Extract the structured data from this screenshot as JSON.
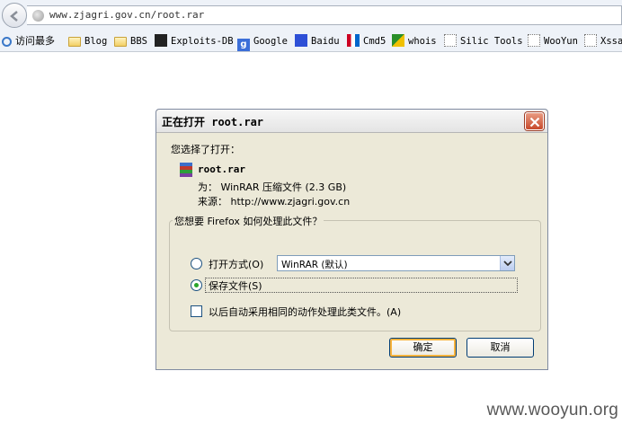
{
  "browser": {
    "url": "www.zjagri.gov.cn/root.rar",
    "bookmarks": [
      {
        "label": "访问最多",
        "icon": "search-icon"
      },
      {
        "label": "Blog",
        "icon": "folder-icon"
      },
      {
        "label": "BBS",
        "icon": "folder-icon"
      },
      {
        "label": "Exploits-DB",
        "icon": "exploits-db-icon"
      },
      {
        "label": "Google",
        "icon": "google-icon"
      },
      {
        "label": "Baidu",
        "icon": "baidu-paw-icon"
      },
      {
        "label": "Cmd5",
        "icon": "cmd5-icon"
      },
      {
        "label": "whois",
        "icon": "whois-icon"
      },
      {
        "label": "Silic Tools",
        "icon": "dotted-page-icon"
      },
      {
        "label": "WooYun",
        "icon": "dotted-page-icon"
      },
      {
        "label": "Xssa",
        "icon": "dotted-page-icon"
      }
    ]
  },
  "dialog": {
    "title": "正在打开 root.rar",
    "intro": "您选择了打开：",
    "file_name": "root.rar",
    "type_line": "为： WinRAR 压缩文件 (2.3 GB)",
    "source_line": "来源： http://www.zjagri.gov.cn",
    "group_title": "您想要 Firefox 如何处理此文件？",
    "open_with_label": "打开方式(O)",
    "open_with_value": "WinRAR (默认)",
    "save_label": "保存文件(S)",
    "remember_label": "以后自动采用相同的动作处理此类文件。(A)",
    "ok_label": "确定",
    "cancel_label": "取消"
  },
  "watermark": "www.wooyun.org",
  "colors": {
    "dialog_bg": "#ece9d8",
    "close_button": "#c74a2c",
    "radio_checked": "#2aa52a"
  }
}
